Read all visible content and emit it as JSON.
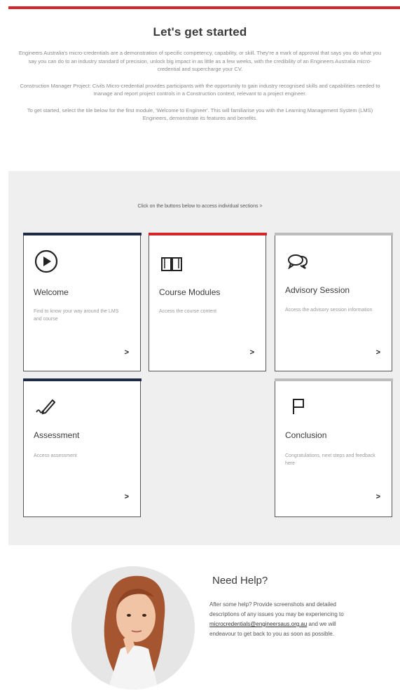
{
  "intro": {
    "title": "Let's get started",
    "paragraph_1": "Engineers Australia's micro-credentials are a demonstration of specific competency, capability, or skill. They're a mark of approval that says you do what you say you can do to an industry standard of precision, unlock big impact in as little as a few weeks, with the credibility of an Engineers Australia micro-credential and supercharge your CV.",
    "paragraph_2": "Construction Manager Project: Civils Micro-credential provides participants with the opportunity to gain industry recognised skills and capabilities needed to manage and report project controls in a Construction context, relevant to a project engineer.",
    "paragraph_3": "To get started, select the tile below for the first module, 'Welcome to Engineer'. This will familiarise you with the Learning Management System (LMS) Engineers, demonstrate its features and benefits."
  },
  "sections": {
    "instruction": "Click on the buttons below to access individual sections >",
    "cards": [
      {
        "title": "Welcome",
        "description": "Find to know your way around the LMS and course",
        "icon": "play-circle-icon",
        "accent": "#1f2a44"
      },
      {
        "title": "Course Modules",
        "description": "Access the course content",
        "icon": "book-icon",
        "accent": "#d3262b"
      },
      {
        "title": "Advisory Session",
        "description": "Access the advisory session information",
        "icon": "chat-bubbles-icon",
        "accent": "#bdbdbd"
      },
      {
        "title": "Assessment",
        "description": "Access assessment",
        "icon": "pencil-icon",
        "accent": "#1f2a44"
      },
      {
        "title": "Conclusion",
        "description": "Congratulations, next steps and feedback here",
        "icon": "flag-icon",
        "accent": "#bdbdbd"
      }
    ],
    "arrow": ">"
  },
  "help": {
    "title": "Need Help?",
    "text_before": "After some help? Provide screenshots and detailed descriptions of any issues you may be experiencing to",
    "email": "microcredentials@engineersaustralia.org.au",
    "email_display": "microcredentials@engineersaus.org.au",
    "text_after": "and we will endeavour to get back to you as soon as possible."
  }
}
